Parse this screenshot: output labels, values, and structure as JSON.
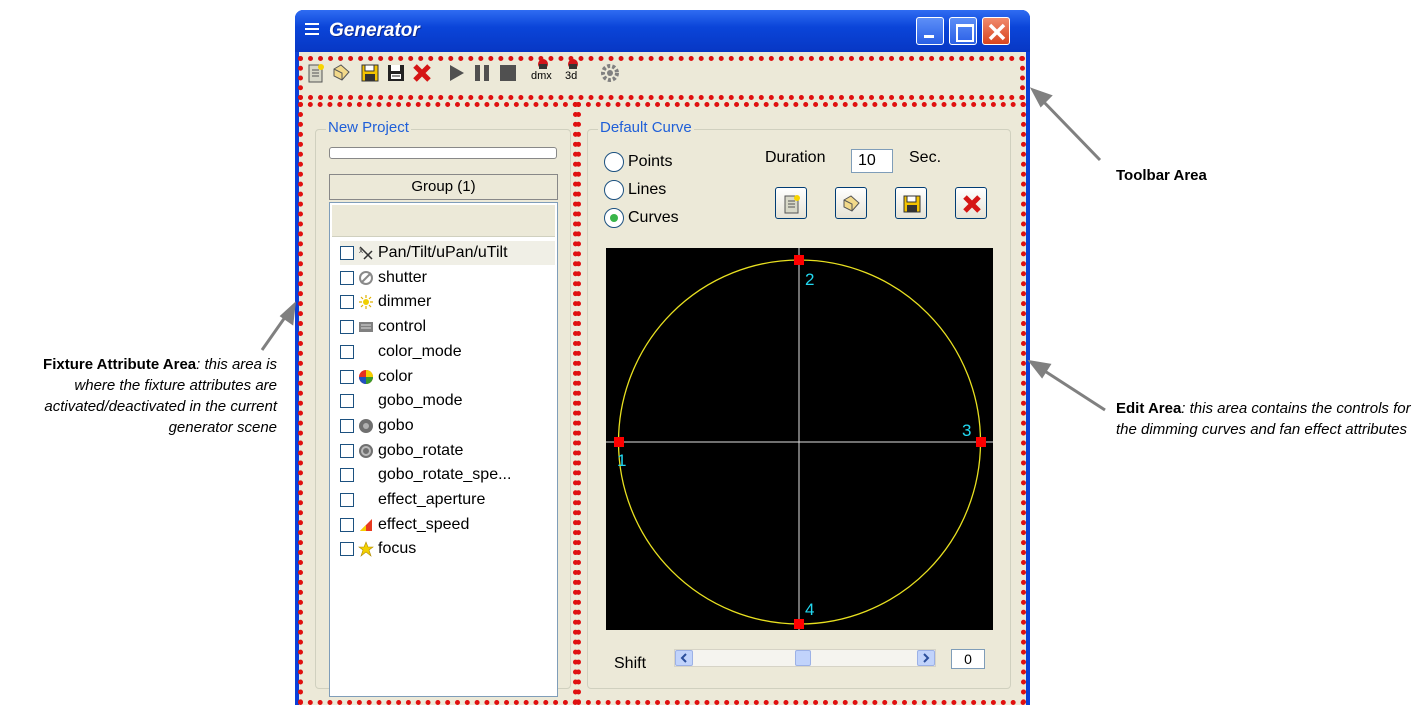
{
  "window": {
    "title": "Generator"
  },
  "toolbar": {
    "icons": [
      "new-icon",
      "open-icon",
      "save-icon",
      "save-as-icon",
      "delete-icon",
      "play-icon",
      "pause-icon",
      "stop-icon",
      "dmx-icon",
      "3d-icon",
      "settings-icon"
    ],
    "dmx_label": "dmx",
    "threed_label": "3d"
  },
  "fixture_panel": {
    "title": "New Project",
    "group_label": "Group (1)",
    "attributes": [
      {
        "name": "Pan/Tilt/uPan/uTilt",
        "icon": "pan-tilt-icon",
        "selected": true
      },
      {
        "name": "shutter",
        "icon": "shutter-icon"
      },
      {
        "name": "dimmer",
        "icon": "dimmer-icon"
      },
      {
        "name": "control",
        "icon": "control-icon"
      },
      {
        "name": "color_mode",
        "icon": ""
      },
      {
        "name": "color",
        "icon": "color-wheel-icon"
      },
      {
        "name": "gobo_mode",
        "icon": ""
      },
      {
        "name": "gobo",
        "icon": "gobo-icon"
      },
      {
        "name": "gobo_rotate",
        "icon": "gobo-rotate-icon"
      },
      {
        "name": "gobo_rotate_spe...",
        "icon": ""
      },
      {
        "name": "effect_aperture",
        "icon": ""
      },
      {
        "name": "effect_speed",
        "icon": "effect-speed-icon"
      },
      {
        "name": "focus",
        "icon": "focus-icon"
      }
    ]
  },
  "edit_panel": {
    "title": "Default Curve",
    "modes": [
      "Points",
      "Lines",
      "Curves"
    ],
    "selected_mode": "Curves",
    "duration_label": "Duration",
    "duration_value": "10",
    "duration_unit": "Sec.",
    "point_labels": [
      "1",
      "2",
      "3",
      "4"
    ],
    "shift_label": "Shift",
    "shift_value": "0"
  },
  "annotations": {
    "toolbar_title": "Toolbar Area",
    "fixture_title": "Fixture Attribute Area",
    "fixture_desc": ": this area is where the fixture attributes are activated/deactivated in the current generator scene",
    "edit_title": "Edit Area",
    "edit_desc": ": this area contains the controls for the dimming curves and fan effect attributes"
  },
  "colors": {
    "title_bar": "#0b45d9",
    "marker_dots": "#e01010",
    "curve": "#e8e020",
    "point_marker": "#ff0000",
    "point_label": "#22d8f0",
    "legend_text": "#1f5fd8"
  }
}
